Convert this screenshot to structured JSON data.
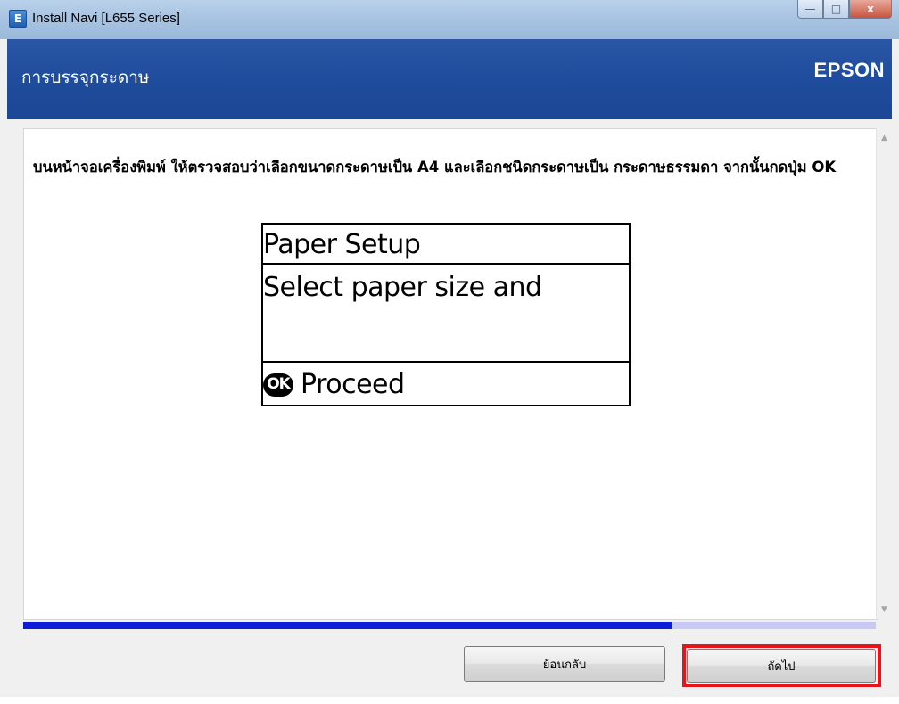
{
  "window": {
    "title": "Install Navi [L655 Series]",
    "icon_letter": "E",
    "controls": {
      "minimize": "—",
      "maximize": "□",
      "close": "x"
    }
  },
  "header": {
    "title": "การบรรจุกระดาษ",
    "brand": "EPSON"
  },
  "content": {
    "instruction": "บนหน้าจอเครื่องพิมพ์ ให้ตรวจสอบว่าเลือกขนาดกระดาษเป็น A4 และเลือกชนิดกระดาษเป็น กระดาษธรรมดา จากนั้นกดปุ่ม OK",
    "lcd": {
      "line1": "Paper Setup",
      "line2": "Select paper size and",
      "ok_label": "OK",
      "line3": "Proceed"
    }
  },
  "scrollbar": {
    "up": "▲",
    "down": "▼"
  },
  "progress": {
    "fraction": 0.76
  },
  "footer": {
    "back_label": "ย้อนกลับ",
    "next_label": "ถัดไป"
  },
  "colors": {
    "header_blue": "#1f4c9c",
    "progress_fill": "#0e1bd8",
    "progress_track": "#c7c9f2",
    "highlight": "#e8141c"
  }
}
